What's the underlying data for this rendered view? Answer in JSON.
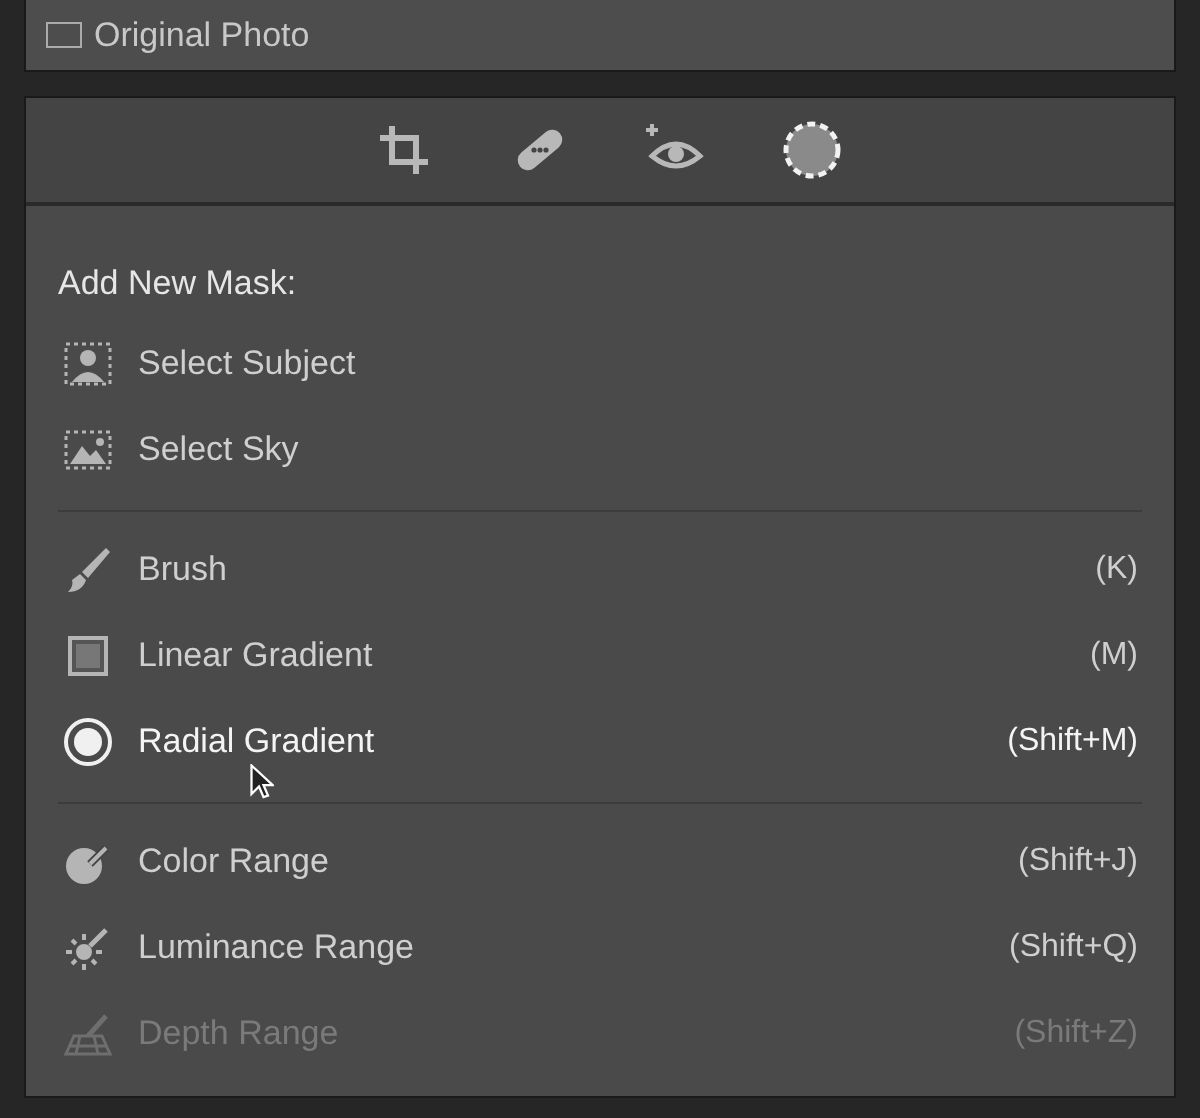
{
  "original_photo": {
    "label": "Original Photo"
  },
  "tools": [
    {
      "kind": "crop",
      "selected": false
    },
    {
      "kind": "heal",
      "selected": false
    },
    {
      "kind": "redeye",
      "selected": false
    },
    {
      "kind": "mask",
      "selected": true
    }
  ],
  "mask_menu": {
    "heading": "Add New Mask:",
    "groups": [
      [
        {
          "kind": "subject",
          "label": "Select Subject",
          "hovered": false,
          "disabled": false
        },
        {
          "kind": "sky",
          "label": "Select Sky",
          "hovered": false,
          "disabled": false
        }
      ],
      [
        {
          "kind": "brush",
          "label": "Brush",
          "shortcut": "(K)",
          "hovered": false,
          "disabled": false
        },
        {
          "kind": "linear",
          "label": "Linear Gradient",
          "shortcut": "(M)",
          "hovered": false,
          "disabled": false
        },
        {
          "kind": "radial",
          "label": "Radial Gradient",
          "shortcut": "(Shift+M)",
          "hovered": true,
          "disabled": false
        }
      ],
      [
        {
          "kind": "color",
          "label": "Color Range",
          "shortcut": "(Shift+J)",
          "hovered": false,
          "disabled": false
        },
        {
          "kind": "luminance",
          "label": "Luminance Range",
          "shortcut": "(Shift+Q)",
          "hovered": false,
          "disabled": false
        },
        {
          "kind": "depth",
          "label": "Depth Range",
          "shortcut": "(Shift+Z)",
          "hovered": false,
          "disabled": true
        }
      ]
    ]
  }
}
